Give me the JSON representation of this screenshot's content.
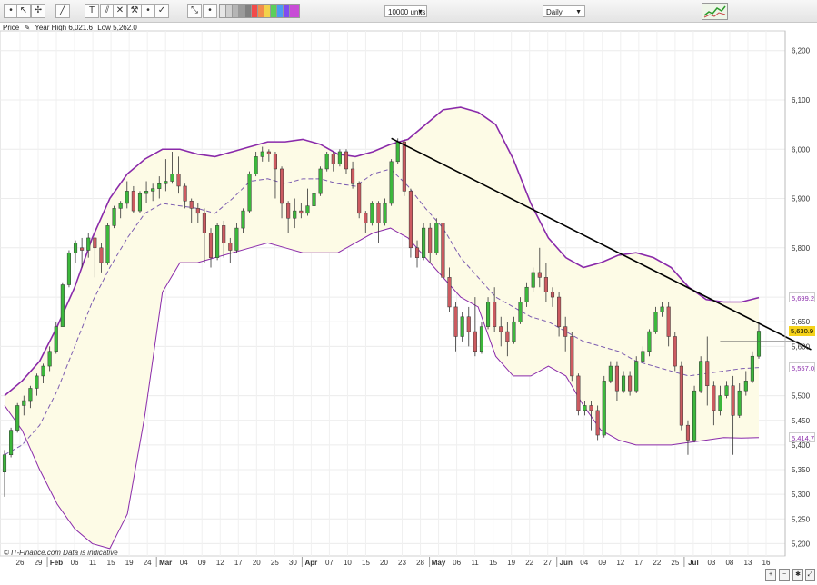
{
  "toolbar": {
    "tools": [
      "ruler-icon",
      "cursor-icon",
      "crosshair-icon",
      "line-icon",
      "text-tool-icon",
      "fibonacci-icon",
      "delete-drawing-icon",
      "hammer-icon",
      "trash-icon",
      "check-icon",
      "resize-icon",
      "zoom-icon"
    ],
    "swatches": [
      "#e6e6e6",
      "#cfcfcf",
      "#b5b5b5",
      "#9a9a9a",
      "#808080",
      "#f24b4b",
      "#f28c4b",
      "#f2d24b",
      "#5bd05b",
      "#4b9bf2",
      "#7f4bf2",
      "#c84bd6"
    ],
    "units_select": "10000 units",
    "period_select": "Daily"
  },
  "info": {
    "label": "Price",
    "year_high": "Year High 6,021.6",
    "low": "Low 5,262.0"
  },
  "watermark": "© IT-Finance.com  Data is indicative",
  "colors": {
    "up": "#3cb83c",
    "down": "#cc5b61",
    "band": "#8a2aaa",
    "band_fill": "#fdfbe6",
    "trend": "#000000"
  },
  "chart_data": {
    "type": "candlestick",
    "instrument_scale": "price",
    "ylim": [
      5175,
      6240
    ],
    "yticks": [
      6200,
      6100,
      6000,
      5900,
      5800,
      5700,
      5650,
      5600,
      5500,
      5450,
      5400,
      5350,
      5300,
      5250,
      5200
    ],
    "ytick_labels": [
      "6,200",
      "6,100",
      "6,000",
      "5,900",
      "5,800",
      "5,700",
      "5,650",
      "5,600",
      "5,500",
      "5,450",
      "5,400",
      "5,350",
      "5,300",
      "5,250",
      "5,200"
    ],
    "x_labels": [
      "26",
      "29",
      "Feb",
      "06",
      "11",
      "15",
      "19",
      "24",
      "Mar",
      "04",
      "09",
      "12",
      "17",
      "20",
      "25",
      "30",
      "Apr",
      "07",
      "10",
      "15",
      "20",
      "23",
      "28",
      "May",
      "06",
      "11",
      "15",
      "19",
      "22",
      "27",
      "Jun",
      "04",
      "09",
      "12",
      "17",
      "22",
      "25",
      "Jul",
      "03",
      "08",
      "13",
      "16"
    ],
    "month_labels": [
      "Feb",
      "Mar",
      "Apr",
      "May",
      "Jun",
      "Jul"
    ],
    "price_tags": [
      {
        "label": "5,699.2",
        "value": 5699.2,
        "kind": "upper-band"
      },
      {
        "label": "5,630.9",
        "value": 5630.9,
        "kind": "last-price"
      },
      {
        "label": "5,557.0",
        "value": 5557.0,
        "kind": "middle-band"
      },
      {
        "label": "5,414.7",
        "value": 5414.7,
        "kind": "lower-band"
      }
    ],
    "candles": [
      [
        5345,
        5380,
        5295,
        5390
      ],
      [
        5380,
        5430,
        5375,
        5435
      ],
      [
        5430,
        5480,
        5425,
        5485
      ],
      [
        5480,
        5490,
        5460,
        5500
      ],
      [
        5490,
        5515,
        5475,
        5520
      ],
      [
        5515,
        5540,
        5500,
        5545
      ],
      [
        5540,
        5560,
        5525,
        5565
      ],
      [
        5560,
        5590,
        5550,
        5600
      ],
      [
        5590,
        5640,
        5585,
        5650
      ],
      [
        5640,
        5725,
        5640,
        5730
      ],
      [
        5725,
        5790,
        5720,
        5795
      ],
      [
        5790,
        5810,
        5770,
        5815
      ],
      [
        5800,
        5795,
        5760,
        5820
      ],
      [
        5795,
        5820,
        5780,
        5830
      ],
      [
        5820,
        5800,
        5740,
        5825
      ],
      [
        5800,
        5770,
        5750,
        5810
      ],
      [
        5770,
        5845,
        5765,
        5850
      ],
      [
        5845,
        5880,
        5840,
        5885
      ],
      [
        5880,
        5890,
        5860,
        5895
      ],
      [
        5890,
        5915,
        5880,
        5935
      ],
      [
        5915,
        5875,
        5870,
        5925
      ],
      [
        5875,
        5910,
        5870,
        5915
      ],
      [
        5910,
        5915,
        5890,
        5935
      ],
      [
        5915,
        5920,
        5895,
        5930
      ],
      [
        5920,
        5930,
        5900,
        5945
      ],
      [
        5930,
        5935,
        5915,
        5980
      ],
      [
        5935,
        5950,
        5930,
        5995
      ],
      [
        5950,
        5925,
        5910,
        5985
      ],
      [
        5925,
        5895,
        5880,
        5930
      ],
      [
        5895,
        5880,
        5850,
        5900
      ],
      [
        5880,
        5870,
        5850,
        5890
      ],
      [
        5870,
        5830,
        5770,
        5880
      ],
      [
        5830,
        5780,
        5760,
        5840
      ],
      [
        5780,
        5845,
        5775,
        5850
      ],
      [
        5845,
        5810,
        5780,
        5855
      ],
      [
        5810,
        5795,
        5770,
        5820
      ],
      [
        5795,
        5840,
        5790,
        5850
      ],
      [
        5840,
        5875,
        5830,
        5880
      ],
      [
        5875,
        5950,
        5870,
        5955
      ],
      [
        5950,
        5985,
        5945,
        5995
      ],
      [
        5985,
        5995,
        5975,
        6005
      ],
      [
        5995,
        5990,
        5975,
        6000
      ],
      [
        5990,
        5960,
        5900,
        5995
      ],
      [
        5960,
        5890,
        5860,
        5965
      ],
      [
        5890,
        5860,
        5830,
        5895
      ],
      [
        5860,
        5875,
        5840,
        5900
      ],
      [
        5875,
        5870,
        5860,
        5890
      ],
      [
        5870,
        5885,
        5865,
        5920
      ],
      [
        5885,
        5910,
        5880,
        5915
      ],
      [
        5910,
        5960,
        5905,
        5965
      ],
      [
        5960,
        5990,
        5955,
        5995
      ],
      [
        5990,
        5970,
        5955,
        5995
      ],
      [
        5970,
        5995,
        5965,
        6000
      ],
      [
        5995,
        5960,
        5950,
        6000
      ],
      [
        5960,
        5930,
        5920,
        5975
      ],
      [
        5930,
        5870,
        5860,
        5935
      ],
      [
        5870,
        5850,
        5830,
        5875
      ],
      [
        5850,
        5890,
        5845,
        5895
      ],
      [
        5890,
        5850,
        5810,
        5895
      ],
      [
        5850,
        5890,
        5845,
        5900
      ],
      [
        5890,
        5975,
        5885,
        5980
      ],
      [
        5975,
        6015,
        5970,
        6022
      ],
      [
        6015,
        5915,
        5905,
        6020
      ],
      [
        5915,
        5800,
        5780,
        5920
      ],
      [
        5800,
        5780,
        5760,
        5815
      ],
      [
        5780,
        5840,
        5775,
        5850
      ],
      [
        5840,
        5790,
        5770,
        5850
      ],
      [
        5790,
        5850,
        5785,
        5860
      ],
      [
        5850,
        5740,
        5730,
        5900
      ],
      [
        5740,
        5680,
        5670,
        5760
      ],
      [
        5680,
        5620,
        5590,
        5690
      ],
      [
        5620,
        5660,
        5610,
        5670
      ],
      [
        5660,
        5630,
        5600,
        5680
      ],
      [
        5630,
        5590,
        5580,
        5700
      ],
      [
        5590,
        5640,
        5585,
        5650
      ],
      [
        5640,
        5690,
        5635,
        5700
      ],
      [
        5690,
        5640,
        5630,
        5720
      ],
      [
        5640,
        5630,
        5600,
        5660
      ],
      [
        5630,
        5610,
        5580,
        5650
      ],
      [
        5610,
        5650,
        5605,
        5660
      ],
      [
        5650,
        5690,
        5645,
        5700
      ],
      [
        5690,
        5720,
        5680,
        5730
      ],
      [
        5720,
        5750,
        5710,
        5760
      ],
      [
        5750,
        5740,
        5720,
        5800
      ],
      [
        5740,
        5710,
        5690,
        5770
      ],
      [
        5710,
        5700,
        5680,
        5720
      ],
      [
        5700,
        5640,
        5620,
        5710
      ],
      [
        5640,
        5620,
        5590,
        5660
      ],
      [
        5620,
        5540,
        5530,
        5630
      ],
      [
        5540,
        5470,
        5460,
        5545
      ],
      [
        5470,
        5480,
        5460,
        5490
      ],
      [
        5480,
        5470,
        5430,
        5490
      ],
      [
        5470,
        5420,
        5410,
        5480
      ],
      [
        5420,
        5530,
        5415,
        5540
      ],
      [
        5530,
        5560,
        5525,
        5570
      ],
      [
        5560,
        5510,
        5490,
        5570
      ],
      [
        5510,
        5540,
        5505,
        5550
      ],
      [
        5540,
        5510,
        5500,
        5550
      ],
      [
        5510,
        5570,
        5505,
        5580
      ],
      [
        5570,
        5590,
        5565,
        5600
      ],
      [
        5590,
        5630,
        5580,
        5635
      ],
      [
        5630,
        5670,
        5625,
        5680
      ],
      [
        5670,
        5680,
        5660,
        5690
      ],
      [
        5680,
        5620,
        5600,
        5690
      ],
      [
        5620,
        5560,
        5550,
        5630
      ],
      [
        5560,
        5440,
        5430,
        5570
      ],
      [
        5440,
        5410,
        5380,
        5450
      ],
      [
        5410,
        5510,
        5405,
        5520
      ],
      [
        5510,
        5570,
        5505,
        5580
      ],
      [
        5570,
        5520,
        5480,
        5620
      ],
      [
        5520,
        5470,
        5440,
        5530
      ],
      [
        5470,
        5500,
        5460,
        5520
      ],
      [
        5500,
        5520,
        5495,
        5530
      ],
      [
        5520,
        5460,
        5380,
        5540
      ],
      [
        5460,
        5510,
        5455,
        5525
      ],
      [
        5510,
        5530,
        5500,
        5550
      ],
      [
        5530,
        5580,
        5525,
        5590
      ],
      [
        5580,
        5631,
        5575,
        5645
      ]
    ],
    "bollinger": {
      "upper": [
        5500,
        5530,
        5570,
        5640,
        5720,
        5820,
        5900,
        5950,
        5980,
        6000,
        6000,
        5990,
        5985,
        5995,
        6005,
        6015,
        6015,
        6020,
        6010,
        5990,
        5985,
        5995,
        6010,
        6020,
        6050,
        6080,
        6085,
        6075,
        6050,
        5980,
        5890,
        5820,
        5780,
        5760,
        5770,
        5785,
        5790,
        5780,
        5760,
        5720,
        5695,
        5690,
        5690,
        5699
      ],
      "middle": [
        5380,
        5400,
        5440,
        5510,
        5600,
        5690,
        5760,
        5820,
        5870,
        5890,
        5885,
        5880,
        5870,
        5900,
        5935,
        5940,
        5930,
        5940,
        5940,
        5930,
        5925,
        5950,
        5960,
        5925,
        5880,
        5840,
        5780,
        5740,
        5700,
        5680,
        5660,
        5650,
        5630,
        5610,
        5600,
        5590,
        5570,
        5560,
        5550,
        5540,
        5545,
        5550,
        5555,
        5557
      ],
      "lower": [
        5480,
        5430,
        5350,
        5280,
        5230,
        5200,
        5190,
        5260,
        5460,
        5710,
        5770,
        5770,
        5780,
        5790,
        5800,
        5810,
        5800,
        5790,
        5790,
        5790,
        5810,
        5830,
        5840,
        5820,
        5780,
        5740,
        5700,
        5680,
        5580,
        5540,
        5540,
        5560,
        5540,
        5480,
        5430,
        5410,
        5400,
        5400,
        5400,
        5405,
        5410,
        5415,
        5414,
        5415
      ]
    },
    "trendline": {
      "from": {
        "index": 60,
        "value": 6022
      },
      "to": {
        "index": 122,
        "value": 5575
      }
    },
    "resistance_line": {
      "from_index": 111,
      "to_index": 120,
      "value": 5610
    }
  }
}
